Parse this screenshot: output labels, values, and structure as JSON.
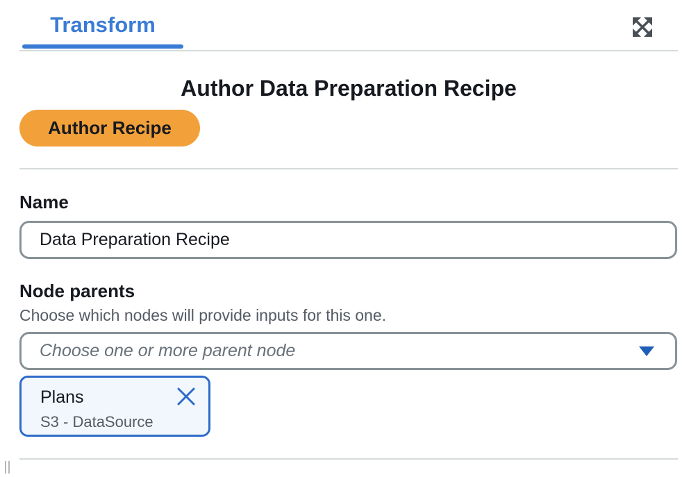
{
  "tabs": [
    {
      "label": "Transform",
      "active": true
    }
  ],
  "toolbar": {
    "expand_icon": "expand-arrows-icon"
  },
  "panel": {
    "heading": "Author Data Preparation Recipe",
    "author_button": "Author Recipe"
  },
  "name_field": {
    "label": "Name",
    "value": "Data Preparation Recipe"
  },
  "node_parents": {
    "label": "Node parents",
    "description": "Choose which nodes will provide inputs for this one.",
    "placeholder": "Choose one or more parent node",
    "selected": [
      {
        "title": "Plans",
        "subtitle": "S3 - DataSource"
      }
    ]
  },
  "colors": {
    "accent": "#3a7bd5",
    "button": "#f2a03a",
    "token_border": "#2e6bc9",
    "token_bg": "#f1f7fd"
  }
}
